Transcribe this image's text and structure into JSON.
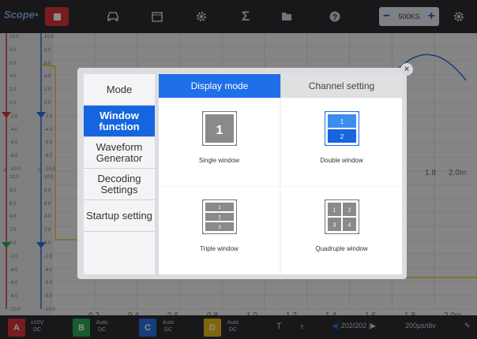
{
  "app": {
    "logo_text": "Scope",
    "logo_suffix": "•"
  },
  "toolbar": {
    "rate_minus": "−",
    "rate_value": "500KS",
    "rate_plus": "+",
    "icons": [
      "stop-icon",
      "car-icon",
      "calendar-icon",
      "gear-icon",
      "sigma-icon",
      "folder-icon",
      "help-icon",
      "settings-icon"
    ]
  },
  "plot": {
    "y_ticks_a": [
      "10.0",
      "8.0",
      "6.0",
      "4.0",
      "2.0",
      "0.0",
      "-2.0",
      "-4.0",
      "-6.0",
      "-8.0",
      "-10.0"
    ],
    "y_ticks_b": [
      "10.0",
      "8.0",
      "6.0",
      "4.0",
      "2.0",
      "0.0",
      "-2.0",
      "-4.0",
      "-6.0",
      "-8.0",
      "-10.0"
    ],
    "channel_a_unit": "A",
    "channel_c_unit": "C",
    "x_labels": [
      "0.2",
      "0.4",
      "0.6",
      "0.8",
      "1.0",
      "1.2",
      "1.4",
      "1.6",
      "1.8",
      "2.0m"
    ],
    "mid_x_labels": [
      "1.8",
      "2.0m"
    ]
  },
  "bottom": {
    "ch_a": "A",
    "ch_a_range": "±10V",
    "ch_a_coupling": "DC",
    "ch_b": "B",
    "ch_b_range": "Auto",
    "ch_b_coupling": "DC",
    "ch_c": "C",
    "ch_c_range": "Auto",
    "ch_c_coupling": "DC",
    "ch_d": "D",
    "ch_d_range": "Auto",
    "ch_d_coupling": "DC",
    "trigger": "T",
    "pulse": "ⲧ",
    "pages": "202/202",
    "timebase": "200µs/div"
  },
  "dialog": {
    "close": "×",
    "menu": [
      {
        "label": "Mode",
        "active": false
      },
      {
        "label": "Window function",
        "active": true
      },
      {
        "label": "Waveform Generator",
        "active": false
      },
      {
        "label": "Decoding Settings",
        "active": false
      },
      {
        "label": "Startup setting",
        "active": false
      }
    ],
    "tabs": {
      "display": "Display mode",
      "channel": "Channel setting"
    },
    "options": [
      {
        "label": "Single window",
        "nums": [
          "1"
        ]
      },
      {
        "label": "Double window",
        "nums": [
          "1",
          "2"
        ]
      },
      {
        "label": "Triple window",
        "nums": [
          "1",
          "2",
          "3"
        ]
      },
      {
        "label": "Quadruple window",
        "nums": [
          "1",
          "2",
          "3",
          "4"
        ]
      }
    ]
  },
  "colors": {
    "accent": "#1f6fe8",
    "ch_a": "#d9343a",
    "ch_b": "#2fa84f",
    "ch_c": "#2b6fe0",
    "ch_d": "#e8b81a"
  }
}
